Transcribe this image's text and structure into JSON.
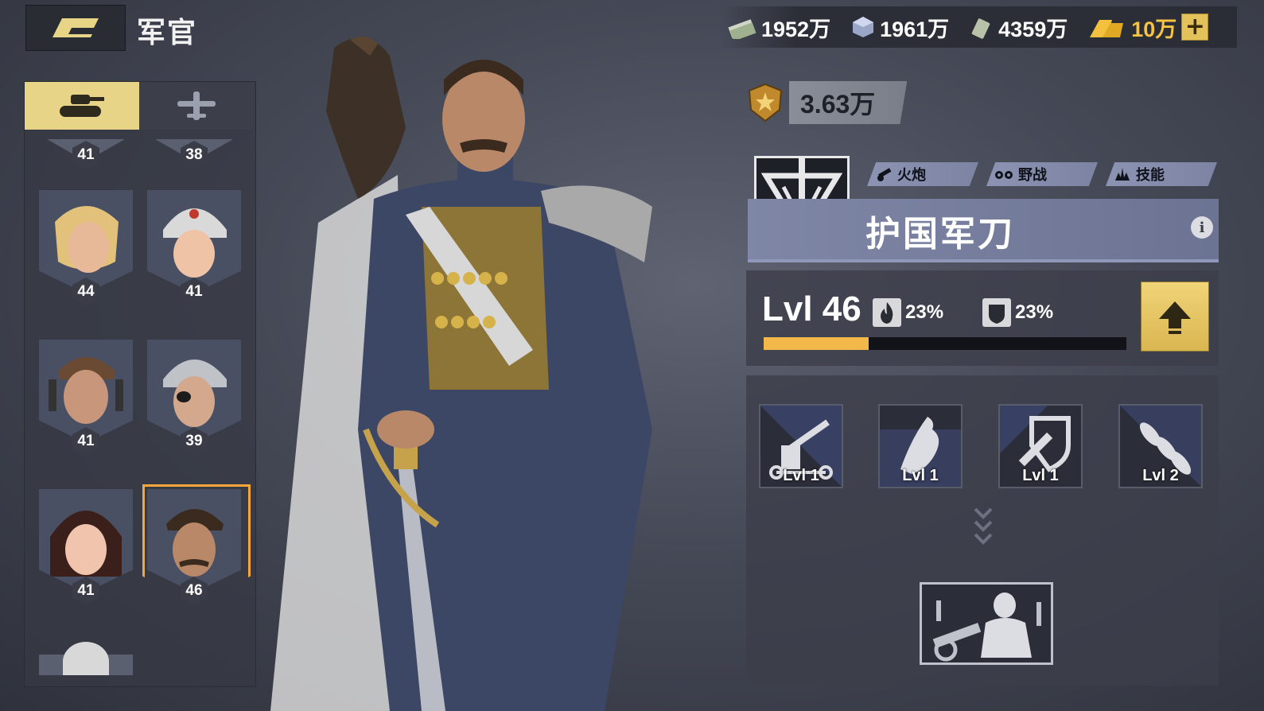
{
  "header": {
    "title": "军官"
  },
  "resources": [
    {
      "icon": "cash-icon",
      "value": "1952万"
    },
    {
      "icon": "steel-cube-icon",
      "value": "1961万"
    },
    {
      "icon": "oil-can-icon",
      "value": "4359万"
    },
    {
      "icon": "gold-bars-icon",
      "value": "10万"
    }
  ],
  "plus_label": "+",
  "unit_tabs": [
    {
      "icon": "tank-icon",
      "active": true
    },
    {
      "icon": "plane-icon",
      "active": false
    }
  ],
  "officer_list": [
    {
      "level": "41"
    },
    {
      "level": "38"
    },
    {
      "level": "44"
    },
    {
      "level": "41"
    },
    {
      "level": "41"
    },
    {
      "level": "39"
    },
    {
      "level": "41"
    },
    {
      "level": "46",
      "selected": true
    }
  ],
  "officer": {
    "power": "3.63万",
    "tags": [
      "火炮",
      "野战",
      "技能"
    ],
    "name": "护国军刀",
    "level_label": "Lvl 46",
    "attack_bonus": "23%",
    "defense_bonus": "23%",
    "xp_progress": 0.29,
    "info_label": "i"
  },
  "skills": [
    {
      "icon": "artillery-skill-icon",
      "level": "Lvl 1"
    },
    {
      "icon": "eagle-skill-icon",
      "level": "Lvl 1"
    },
    {
      "icon": "shield-rocket-skill-icon",
      "level": "Lvl 1"
    },
    {
      "icon": "shells-skill-icon",
      "level": "Lvl 2"
    }
  ],
  "colors": {
    "accent_gold": "#e8d487",
    "progress": "#f3b84a",
    "banner": "#7f86a6",
    "selected_glow": "#f6a63b"
  }
}
